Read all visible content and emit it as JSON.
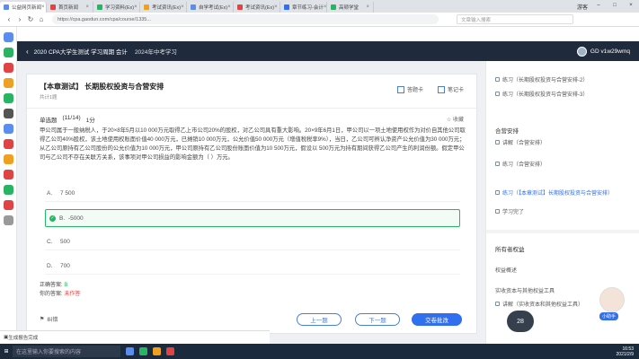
{
  "browser": {
    "tabs": [
      {
        "label": "公益网页新闻",
        "color": "#5b8def"
      },
      {
        "label": "首页新闻",
        "color": "#e04343"
      },
      {
        "label": "学习资料(Ex)",
        "color": "#29b463"
      },
      {
        "label": "考试资讯(Ex)",
        "color": "#f0a020"
      },
      {
        "label": "自学考试(Ex)",
        "color": "#5b8def"
      },
      {
        "label": "考试资讯(Ex)",
        "color": "#e04343"
      },
      {
        "label": "章节练习-会计",
        "color": "#2f6ff0"
      },
      {
        "label": "高顿学堂",
        "color": "#29b463"
      }
    ],
    "url": "https://cpa.gaodun.com/cpa/course/1335...",
    "search": "文章输入搜索",
    "user_label": "游客"
  },
  "site": {
    "course": "2020 CPA大学生测试 学习周期 会计",
    "tag": "2024年中考学习",
    "user": "GD v1w29wmq"
  },
  "card": {
    "title": "【本章测试】 长期股权投资与合营安排",
    "subtitle": "共计1题",
    "tool1": "答题卡",
    "tool2": "笔记卡",
    "qtype": "单选题",
    "qnum": "(11/14)",
    "score": "1分",
    "fav": "收藏",
    "stem": "甲公司属于一般纳税人，于20×8年5月以10 000万元取得乙上市公司20%的股权，对乙公司具有重大影响。20×9年6月1日，甲公司以一项土地使用权作为对价自其他公司取得乙公司40%股权，该土地使用权账面价值40 000万元，已摊销10 000万元，公允价值50 000万元（增值税税率9%），当日，乙公司可辨认净资产公允价值为30 000万元；从乙公司原持有乙公司股份的公允价值为10 000万元，甲公司原持有乙公司股份账面价值为10 500万元，假设以 500万元为持有期间获得乙公司产生的利润份额。假定甲公司与乙公司不存在关联方关系，该事项对甲公司损益的影响金额为（    ）万元。",
    "options": [
      {
        "key": "A.",
        "text": "7 500"
      },
      {
        "key": "B.",
        "text": "-5000"
      },
      {
        "key": "C.",
        "text": "500"
      },
      {
        "key": "D.",
        "text": "700"
      }
    ],
    "correct_label": "正确答案:",
    "correct": "B",
    "your_label": "你的答案:",
    "your": "未作答",
    "bottom_label": "纠错",
    "prev": "上一题",
    "next": "下一题",
    "submit": "交卷批改"
  },
  "side": {
    "items_top": [
      "练习（长期股权投资与合营安排-2）",
      "练习（长期股权投资与合营安排-3）"
    ],
    "section2": "合营安排",
    "items2": [
      "讲解（合营安排）",
      "练习（合营安排）",
      "练习（【本章测试】长期股权投资与合营安排）",
      "学习完了"
    ],
    "section3": "所有者权益",
    "items3": [
      "权益概述",
      "实收资本与其他权益工具",
      "讲解（实收资本和其他权益工具）"
    ],
    "play": "28",
    "live": "小助手"
  },
  "taskbar": {
    "search": "在这里输入你要搜索的内容",
    "time": "16:53",
    "date": "2021/2/9"
  },
  "download": "生成报告完成"
}
